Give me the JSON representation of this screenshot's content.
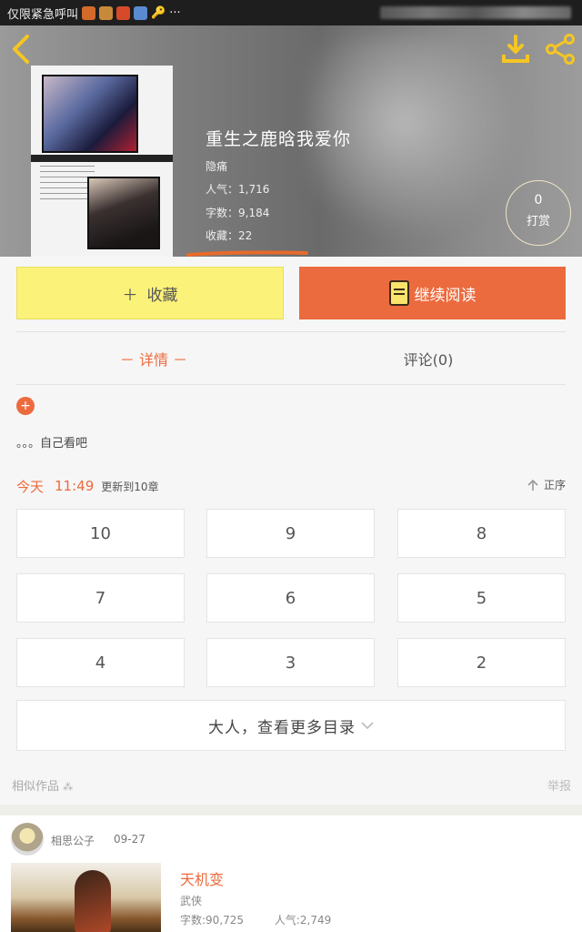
{
  "status_bar": {
    "text": "仅限紧急呼叫",
    "more": "···"
  },
  "book": {
    "title": "重生之鹿晗我爱你",
    "author": "隐痛",
    "popularity": "人气：1,716",
    "words": "字数：9,184",
    "favorites": "收藏：22"
  },
  "reward": {
    "count": "0",
    "label": "打赏"
  },
  "actions": {
    "favorite": "收藏",
    "favorite_prefix": "＋",
    "continue": "继续阅读"
  },
  "tabs": {
    "detail": "－ 详情 －",
    "comments": "评论(0)"
  },
  "expand_symbol": "+",
  "description": "。。。自己看吧",
  "update": {
    "day": "今天",
    "time": "11:49",
    "text": "更新到10章",
    "sort": "正序"
  },
  "chapters": [
    "10",
    "9",
    "8",
    "7",
    "6",
    "5",
    "4",
    "3",
    "2"
  ],
  "more_toc": "大人，查看更多目录",
  "similar_label": "相似作品",
  "report": "举报",
  "similar_item": {
    "user": "相思公子",
    "date": "09-27",
    "title": "天机变",
    "genre": "武侠",
    "words": "字数:90,725",
    "popularity": "人气:2,749"
  },
  "colors": {
    "accent": "#ec6b3e",
    "favorite_bg": "#fbf27a",
    "icon_yellow": "#f5c623"
  }
}
